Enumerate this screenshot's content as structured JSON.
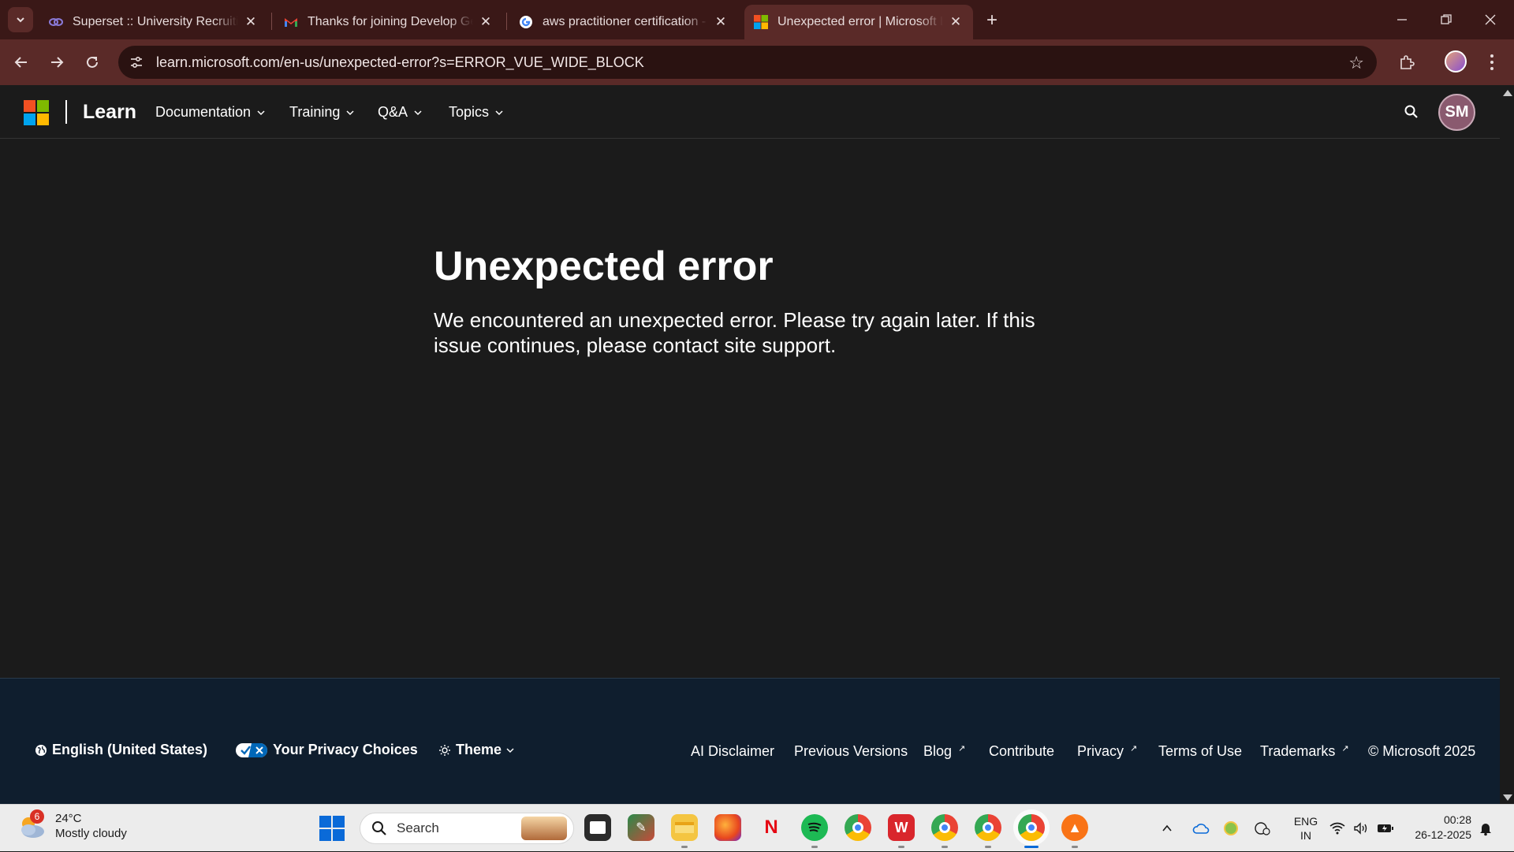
{
  "browser": {
    "tabs": [
      {
        "title": "Superset :: University Recruiting",
        "icon": "superset-icon",
        "active": false
      },
      {
        "title": "Thanks for joining Develop Gen",
        "icon": "gmail-icon",
        "active": false
      },
      {
        "title": "aws practitioner certification - G",
        "icon": "google-icon",
        "active": false
      },
      {
        "title": "Unexpected error | Microsoft Le",
        "icon": "microsoft-icon",
        "active": true
      }
    ],
    "url": "learn.microsoft.com/en-us/unexpected-error?s=ERROR_VUE_WIDE_BLOCK",
    "colors": {
      "tabbar": "#3a1817",
      "toolbar": "#5a2a28"
    }
  },
  "site": {
    "brand": "Learn",
    "nav": [
      "Documentation",
      "Training",
      "Q&A",
      "Topics"
    ],
    "user_initials": "SM"
  },
  "error": {
    "title": "Unexpected error",
    "message": "We encountered an unexpected error. Please try again later. If this issue continues, please contact site support."
  },
  "footer": {
    "locale": "English (United States)",
    "privacy_choices": "Your Privacy Choices",
    "theme": "Theme",
    "links": [
      "AI Disclaimer",
      "Previous Versions",
      "Blog",
      "Contribute",
      "Privacy",
      "Terms of Use",
      "Trademarks"
    ],
    "copyright": "© Microsoft 2025"
  },
  "taskbar": {
    "weather_temp": "24°C",
    "weather_desc": "Mostly cloudy",
    "weather_badge": "6",
    "search_placeholder": "Search",
    "lang_line1": "ENG",
    "lang_line2": "IN",
    "time": "00:28",
    "date": "26-12-2025"
  }
}
